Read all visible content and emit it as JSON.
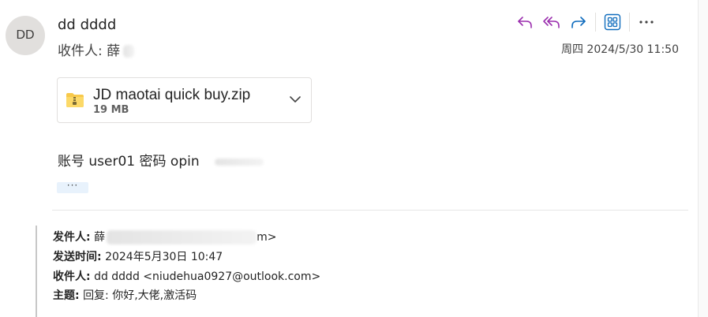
{
  "header": {
    "avatar_initials": "DD",
    "sender_name": "dd dddd",
    "recipient_label": "收件人:",
    "recipient_name": "薛",
    "date": "周四 2024/5/30 11:50"
  },
  "toolbar": {
    "reply_icon": "reply-icon",
    "reply_all_icon": "reply-all-icon",
    "forward_icon": "forward-icon",
    "apps_icon": "apps-icon",
    "more_icon": "more-icon",
    "accent_color": "#9b2fae",
    "apps_color": "#0f6cbd"
  },
  "attachment": {
    "name": "JD maotai quick buy.zip",
    "size": "19 MB",
    "icon": "zip-folder-icon"
  },
  "body": {
    "text": "账号 user01 密码 opin",
    "more_label": "···"
  },
  "quoted": {
    "from_label": "发件人:",
    "from_value": "薛",
    "from_suffix": "m>",
    "sent_label": "发送时间:",
    "sent_value": "2024年5月30日 10:47",
    "to_label": "收件人:",
    "to_value": "dd dddd <niudehua0927@outlook.com>",
    "subject_label": "主题:",
    "subject_value": "回复: 你好,大佬,激活码"
  }
}
